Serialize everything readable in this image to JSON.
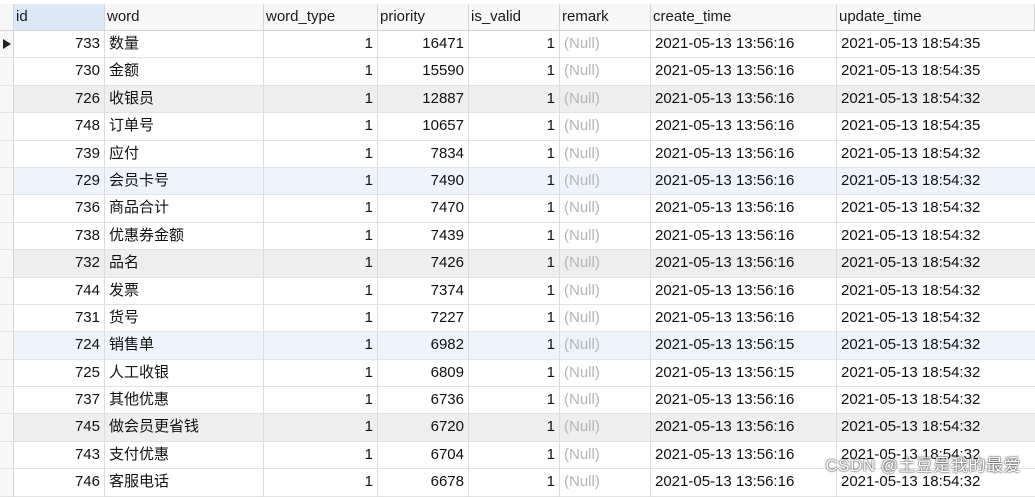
{
  "columns": [
    "id",
    "word",
    "word_type",
    "priority",
    "is_valid",
    "remark",
    "create_time",
    "update_time"
  ],
  "rows": [
    {
      "id": "733",
      "word": "数量",
      "word_type": "1",
      "priority": "16471",
      "is_valid": "1",
      "remark": "(Null)",
      "create_time": "2021-05-13 13:56:16",
      "update_time": "2021-05-13 18:54:35"
    },
    {
      "id": "730",
      "word": "金额",
      "word_type": "1",
      "priority": "15590",
      "is_valid": "1",
      "remark": "(Null)",
      "create_time": "2021-05-13 13:56:16",
      "update_time": "2021-05-13 18:54:35"
    },
    {
      "id": "726",
      "word": "收银员",
      "word_type": "1",
      "priority": "12887",
      "is_valid": "1",
      "remark": "(Null)",
      "create_time": "2021-05-13 13:56:16",
      "update_time": "2021-05-13 18:54:32"
    },
    {
      "id": "748",
      "word": "订单号",
      "word_type": "1",
      "priority": "10657",
      "is_valid": "1",
      "remark": "(Null)",
      "create_time": "2021-05-13 13:56:16",
      "update_time": "2021-05-13 18:54:35"
    },
    {
      "id": "739",
      "word": "应付",
      "word_type": "1",
      "priority": "7834",
      "is_valid": "1",
      "remark": "(Null)",
      "create_time": "2021-05-13 13:56:16",
      "update_time": "2021-05-13 18:54:32"
    },
    {
      "id": "729",
      "word": "会员卡号",
      "word_type": "1",
      "priority": "7490",
      "is_valid": "1",
      "remark": "(Null)",
      "create_time": "2021-05-13 13:56:16",
      "update_time": "2021-05-13 18:54:32"
    },
    {
      "id": "736",
      "word": "商品合计",
      "word_type": "1",
      "priority": "7470",
      "is_valid": "1",
      "remark": "(Null)",
      "create_time": "2021-05-13 13:56:16",
      "update_time": "2021-05-13 18:54:32"
    },
    {
      "id": "738",
      "word": "优惠券金额",
      "word_type": "1",
      "priority": "7439",
      "is_valid": "1",
      "remark": "(Null)",
      "create_time": "2021-05-13 13:56:16",
      "update_time": "2021-05-13 18:54:32"
    },
    {
      "id": "732",
      "word": "品名",
      "word_type": "1",
      "priority": "7426",
      "is_valid": "1",
      "remark": "(Null)",
      "create_time": "2021-05-13 13:56:16",
      "update_time": "2021-05-13 18:54:32"
    },
    {
      "id": "744",
      "word": "发票",
      "word_type": "1",
      "priority": "7374",
      "is_valid": "1",
      "remark": "(Null)",
      "create_time": "2021-05-13 13:56:16",
      "update_time": "2021-05-13 18:54:32"
    },
    {
      "id": "731",
      "word": "货号",
      "word_type": "1",
      "priority": "7227",
      "is_valid": "1",
      "remark": "(Null)",
      "create_time": "2021-05-13 13:56:16",
      "update_time": "2021-05-13 18:54:32"
    },
    {
      "id": "724",
      "word": "销售单",
      "word_type": "1",
      "priority": "6982",
      "is_valid": "1",
      "remark": "(Null)",
      "create_time": "2021-05-13 13:56:15",
      "update_time": "2021-05-13 18:54:32"
    },
    {
      "id": "725",
      "word": "人工收银",
      "word_type": "1",
      "priority": "6809",
      "is_valid": "1",
      "remark": "(Null)",
      "create_time": "2021-05-13 13:56:15",
      "update_time": "2021-05-13 18:54:32"
    },
    {
      "id": "737",
      "word": "其他优惠",
      "word_type": "1",
      "priority": "6736",
      "is_valid": "1",
      "remark": "(Null)",
      "create_time": "2021-05-13 13:56:16",
      "update_time": "2021-05-13 18:54:32"
    },
    {
      "id": "745",
      "word": "做会员更省钱",
      "word_type": "1",
      "priority": "6720",
      "is_valid": "1",
      "remark": "(Null)",
      "create_time": "2021-05-13 13:56:16",
      "update_time": "2021-05-13 18:54:32"
    },
    {
      "id": "743",
      "word": "支付优惠",
      "word_type": "1",
      "priority": "6704",
      "is_valid": "1",
      "remark": "(Null)",
      "create_time": "2021-05-13 13:56:16",
      "update_time": "2021-05-13 18:54:32"
    },
    {
      "id": "746",
      "word": "客服电话",
      "word_type": "1",
      "priority": "6678",
      "is_valid": "1",
      "remark": "(Null)",
      "create_time": "2021-05-13 13:56:16",
      "update_time": "2021-05-13 18:54:32"
    }
  ],
  "watermark": "CSDN @土豆是我的最爱"
}
